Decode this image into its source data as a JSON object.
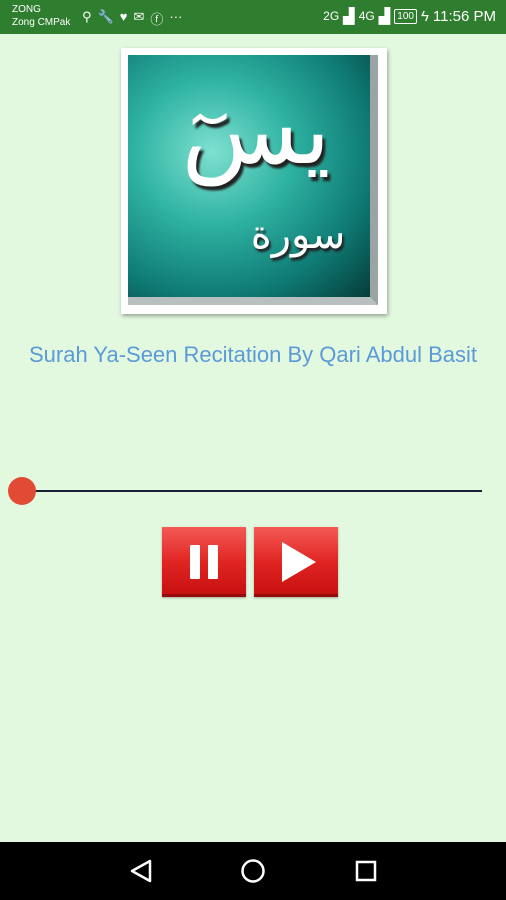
{
  "status_bar": {
    "carrier1": "ZONG",
    "carrier2": "Zong CMPak",
    "signal1": "2G",
    "signal2": "4G",
    "battery": "100",
    "time": "11:56 PM"
  },
  "artwork": {
    "text_main": "يسٓ",
    "text_sub": "سورة"
  },
  "title": "Surah Ya-Seen Recitation By Qari Abdul Basit",
  "player": {
    "progress": 0.0
  },
  "colors": {
    "background": "#e2f9df",
    "status_bar": "#2f7d2e",
    "title": "#5b9ad8",
    "seek_thumb": "#e14a35",
    "button": "#e02522"
  },
  "icons": {
    "pause": "pause-icon",
    "play": "play-icon",
    "back": "back-icon",
    "home": "home-icon",
    "recent": "recent-apps-icon"
  }
}
